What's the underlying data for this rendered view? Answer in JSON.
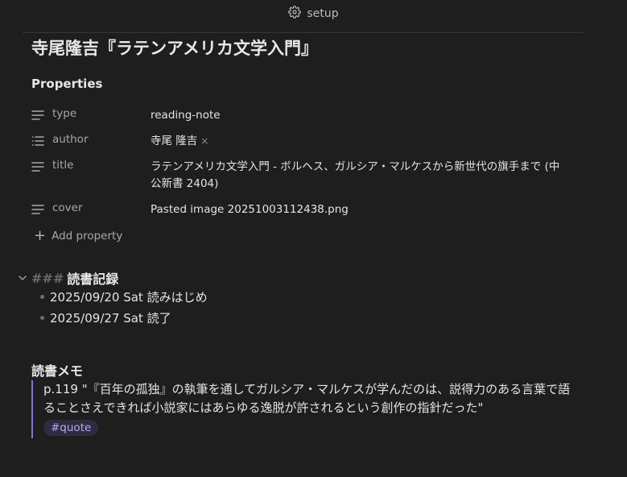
{
  "header": {
    "title": "setup",
    "icon": "gear-icon"
  },
  "document": {
    "title": "寺尾隆吉『ラテンアメリカ文学入門』"
  },
  "properties": {
    "heading": "Properties",
    "items": [
      {
        "icon": "text-lines-icon",
        "key": "type",
        "value": "reading-note"
      },
      {
        "icon": "list-icon",
        "key": "author",
        "value": "寺尾 隆吉",
        "remove": "×"
      },
      {
        "icon": "text-lines-icon",
        "key": "title",
        "value": "ラテンアメリカ文学入門 - ボルヘス、ガルシア・マルケスから新世代の旗手まで (中公新書 2404)"
      },
      {
        "icon": "text-lines-icon",
        "key": "cover",
        "value": "Pasted image 20251003112438.png"
      }
    ],
    "add_label": "Add property"
  },
  "reading_log": {
    "hashes": "###",
    "heading": "読書記録",
    "items": [
      "2025/09/20 Sat 読みはじめ",
      "2025/09/27 Sat 読了"
    ]
  },
  "memo": {
    "heading": "読書メモ",
    "quote": "p.119 \"『百年の孤独』の執筆を通してガルシア・マルケスが学んだのは、説得力のある言葉で語ることさえできれば小説家にはあらゆる逸脱が許されるという創作の指針だった\"",
    "tag": "#quote"
  },
  "colors": {
    "background": "#1e1e1e",
    "accent": "#8a6ee0",
    "tag_text": "#b9a6f0"
  }
}
